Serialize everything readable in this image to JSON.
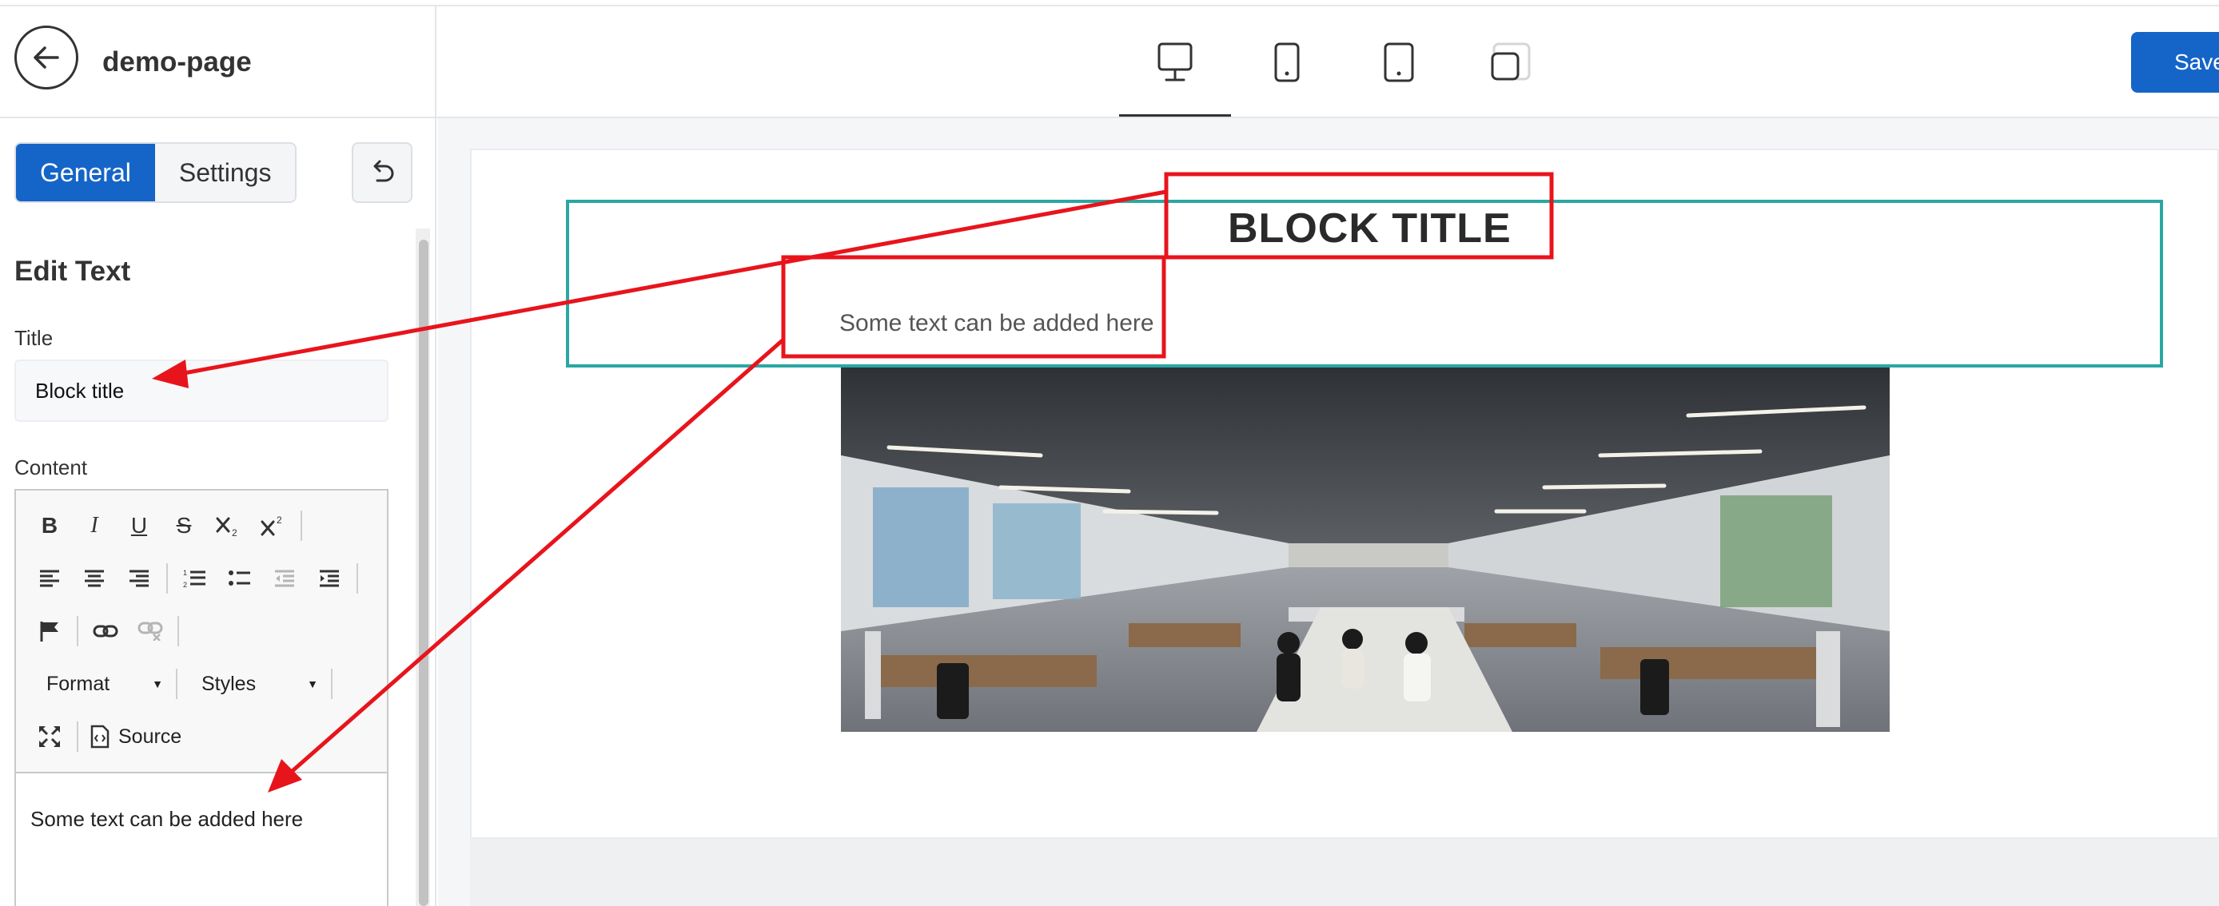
{
  "app": {
    "page_name": "demo-page",
    "save_label": "Save"
  },
  "sidebar": {
    "tabs": [
      {
        "label": "General",
        "active": true
      },
      {
        "label": "Settings",
        "active": false
      }
    ],
    "section_title": "Edit Text",
    "title_field": {
      "label": "Title",
      "value": "Block title"
    },
    "content_field": {
      "label": "Content",
      "toolbar": {
        "format_label": "Format",
        "styles_label": "Styles",
        "source_label": "Source"
      },
      "value": "Some text can be added here"
    }
  },
  "device_bar": {
    "devices": [
      "desktop-icon",
      "tablet-icon",
      "tablet-small-icon",
      "mobile-icon"
    ],
    "active": "desktop"
  },
  "canvas": {
    "block_title": "BLOCK TITLE",
    "block_text": "Some text can be added here",
    "image": "office-interior-photo"
  },
  "colors": {
    "primary": "#1565c8",
    "block_outline": "#2aa7a3",
    "annotation": "#e8141c"
  }
}
